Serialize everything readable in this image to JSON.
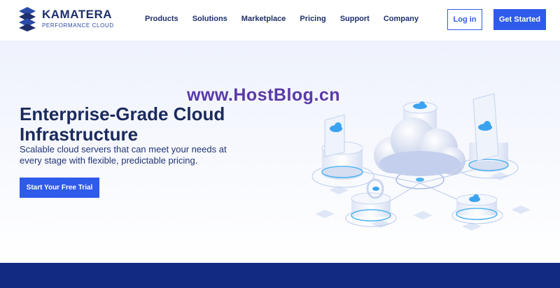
{
  "brand": {
    "name": "KAMATERA",
    "tagline": "PERFORMANCE CLOUD"
  },
  "nav": {
    "items": [
      "Products",
      "Solutions",
      "Marketplace",
      "Pricing",
      "Support",
      "Company"
    ]
  },
  "header": {
    "login_label": "Log in",
    "get_started_label": "Get Started"
  },
  "hero": {
    "title": "Enterprise-Grade Cloud Infrastructure",
    "subtitle": "Scalable cloud servers that can meet your needs at every stage with flexible, predictable pricing.",
    "cta_label": "Start Your Free Trial"
  },
  "watermark": "www.HostBlog.cn",
  "colors": {
    "accent": "#2f5bea",
    "navy": "#1e2f6b",
    "footer_band": "#122a82",
    "watermark": "#5a3aa6"
  },
  "icons": {
    "logo": "kamatera-logo-icon",
    "cloud": "cloud-icon"
  }
}
